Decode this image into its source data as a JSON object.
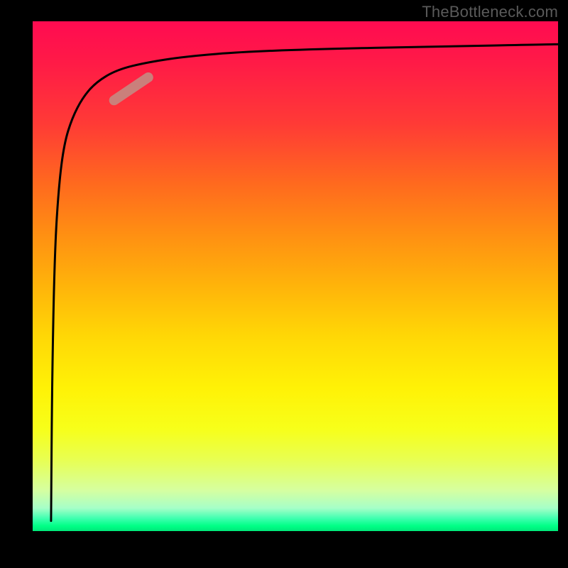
{
  "attribution": "TheBottleneck.com",
  "chart_data": {
    "type": "line",
    "title": "",
    "xlabel": "",
    "ylabel": "",
    "xlim": [
      0,
      100
    ],
    "ylim": [
      0,
      100
    ],
    "grid": false,
    "legend": false,
    "annotations": [],
    "series": [
      {
        "name": "bottleneck-curve",
        "x": [
          3.5,
          3.7,
          4.2,
          5.0,
          6.0,
          7.5,
          9.5,
          12.0,
          16.0,
          22.0,
          30.0,
          40.0,
          55.0,
          75.0,
          100.0
        ],
        "y": [
          2.0,
          30.0,
          55.0,
          68.0,
          76.0,
          81.0,
          85.0,
          88.0,
          90.5,
          92.0,
          93.2,
          94.0,
          94.6,
          95.0,
          95.5
        ]
      }
    ],
    "highlight_segment": {
      "series": "bottleneck-curve",
      "x_range": [
        15.5,
        22.0
      ],
      "y_range": [
        84.5,
        89.0
      ]
    },
    "background": "red-yellow-green-vertical-gradient"
  },
  "colors": {
    "curve_stroke": "#000000",
    "highlight_stroke": "#c48a82",
    "frame": "#000000",
    "attribution_text": "#5a5a5a"
  }
}
